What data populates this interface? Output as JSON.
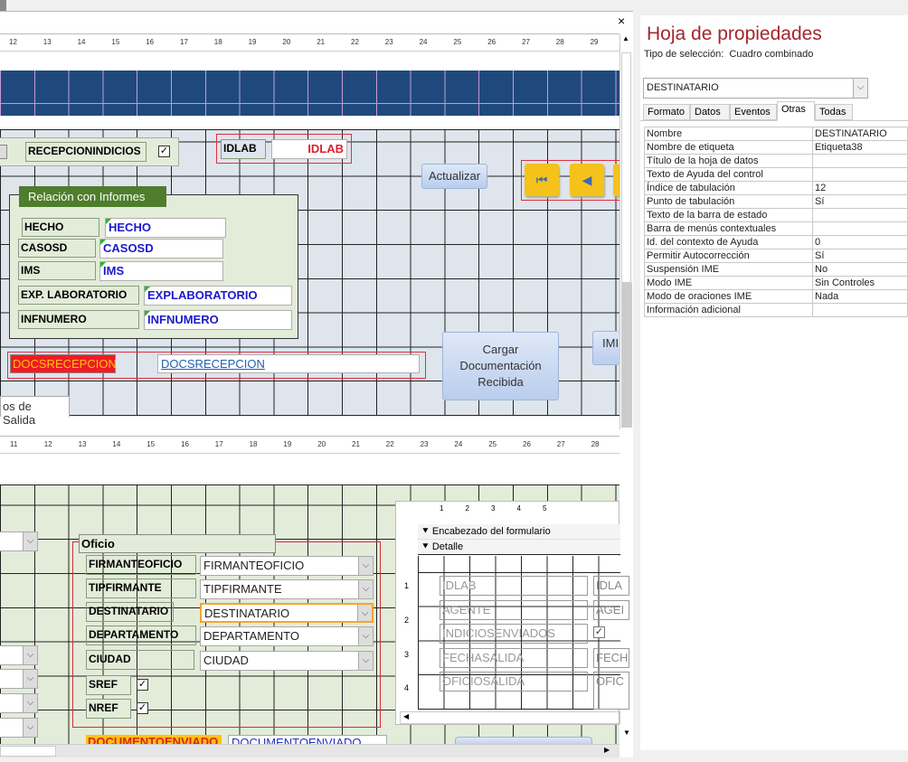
{
  "top_ruler": [
    "12",
    "13",
    "14",
    "15",
    "16",
    "17",
    "18",
    "19",
    "20",
    "21",
    "22",
    "23",
    "24",
    "25",
    "26",
    "27",
    "28",
    "29"
  ],
  "bottom_ruler": [
    "11",
    "12",
    "13",
    "14",
    "15",
    "16",
    "17",
    "18",
    "19",
    "20",
    "21",
    "22",
    "23",
    "24",
    "25",
    "26",
    "27",
    "28"
  ],
  "header": {
    "recepcion_label": "RECEPCIONINDICIOS",
    "idlab_label": "IDLAB",
    "idlab_field": "IDLAB",
    "actualizar": "Actualizar"
  },
  "relacion": {
    "title": "Relación con Informes",
    "rows": [
      {
        "label": "HECHO",
        "field": "HECHO"
      },
      {
        "label": "CASOSD",
        "field": "CASOSD"
      },
      {
        "label": "IMS",
        "field": "IMS"
      },
      {
        "label": "EXP. LABORATORIO",
        "field": "EXPLABORATORIO"
      },
      {
        "label": "INFNUMERO",
        "field": "INFNUMERO"
      }
    ]
  },
  "docs": {
    "label": "DOCSRECEPCION",
    "field": "DOCSRECEPCION"
  },
  "cargar_button": "Cargar Documentación Recibida",
  "imp_button": "IMI",
  "tab_label": "os de Salida",
  "oficio": {
    "title": "Oficio",
    "rows": [
      {
        "label": "FIRMANTEOFICIO",
        "field": "FIRMANTEOFICIO"
      },
      {
        "label": "TIPFIRMANTE",
        "field": "TIPFIRMANTE"
      },
      {
        "label": "DESTINATARIO",
        "field": "DESTINATARIO"
      },
      {
        "label": "DEPARTAMENTO",
        "field": "DEPARTAMENTO"
      },
      {
        "label": "CIUDAD",
        "field": "CIUDAD"
      }
    ],
    "sref": "SREF",
    "nref": "NREF"
  },
  "documento": {
    "label": "DOCUMENTOENVIADO",
    "field": "DOCUMENTOENVIADO"
  },
  "subform": {
    "ruler": [
      "1",
      "2",
      "3",
      "4",
      "5"
    ],
    "side_ruler": [
      "1",
      "2",
      "3",
      "4"
    ],
    "header_section": "Encabezado del formulario",
    "detail_section": "Detalle",
    "labels": [
      "IDLAB",
      "AGENTE",
      "INDICIOSENVIADOS",
      "FECHASALIDA",
      "OFICIOSALIDA"
    ],
    "fields": [
      "IDLA",
      "AGEI",
      "",
      "FECH",
      "OFIC"
    ]
  },
  "property_sheet": {
    "title": "Hoja de propiedades",
    "selection_type_label": "Tipo de selección:",
    "selection_type": "Cuadro combinado",
    "selected_object": "DESTINATARIO",
    "tabs": [
      "Formato",
      "Datos",
      "Eventos",
      "Otras",
      "Todas"
    ],
    "active_tab": "Otras",
    "properties": [
      [
        "Nombre",
        "DESTINATARIO"
      ],
      [
        "Nombre de etiqueta",
        "Etiqueta38"
      ],
      [
        "Título de la hoja de datos",
        ""
      ],
      [
        "Texto de Ayuda del control",
        ""
      ],
      [
        "Índice de tabulación",
        "12"
      ],
      [
        "Punto de tabulación",
        "Sí"
      ],
      [
        "Texto de la barra de estado",
        ""
      ],
      [
        "Barra de menús contextuales",
        ""
      ],
      [
        "Id. del contexto de Ayuda",
        "0"
      ],
      [
        "Permitir Autocorrección",
        "Sí"
      ],
      [
        "Suspensión IME",
        "No"
      ],
      [
        "Modo IME",
        "Sin Controles"
      ],
      [
        "Modo de oraciones IME",
        "Nada"
      ],
      [
        "Información adicional",
        ""
      ]
    ]
  },
  "colors": {
    "header_band": "#1f497d",
    "label_bg": "#e3ecd9",
    "field_text": "#1a1acc",
    "docs_label_bg": "#ed1c24",
    "selection": "#f5a431",
    "title": "#a4262c"
  }
}
